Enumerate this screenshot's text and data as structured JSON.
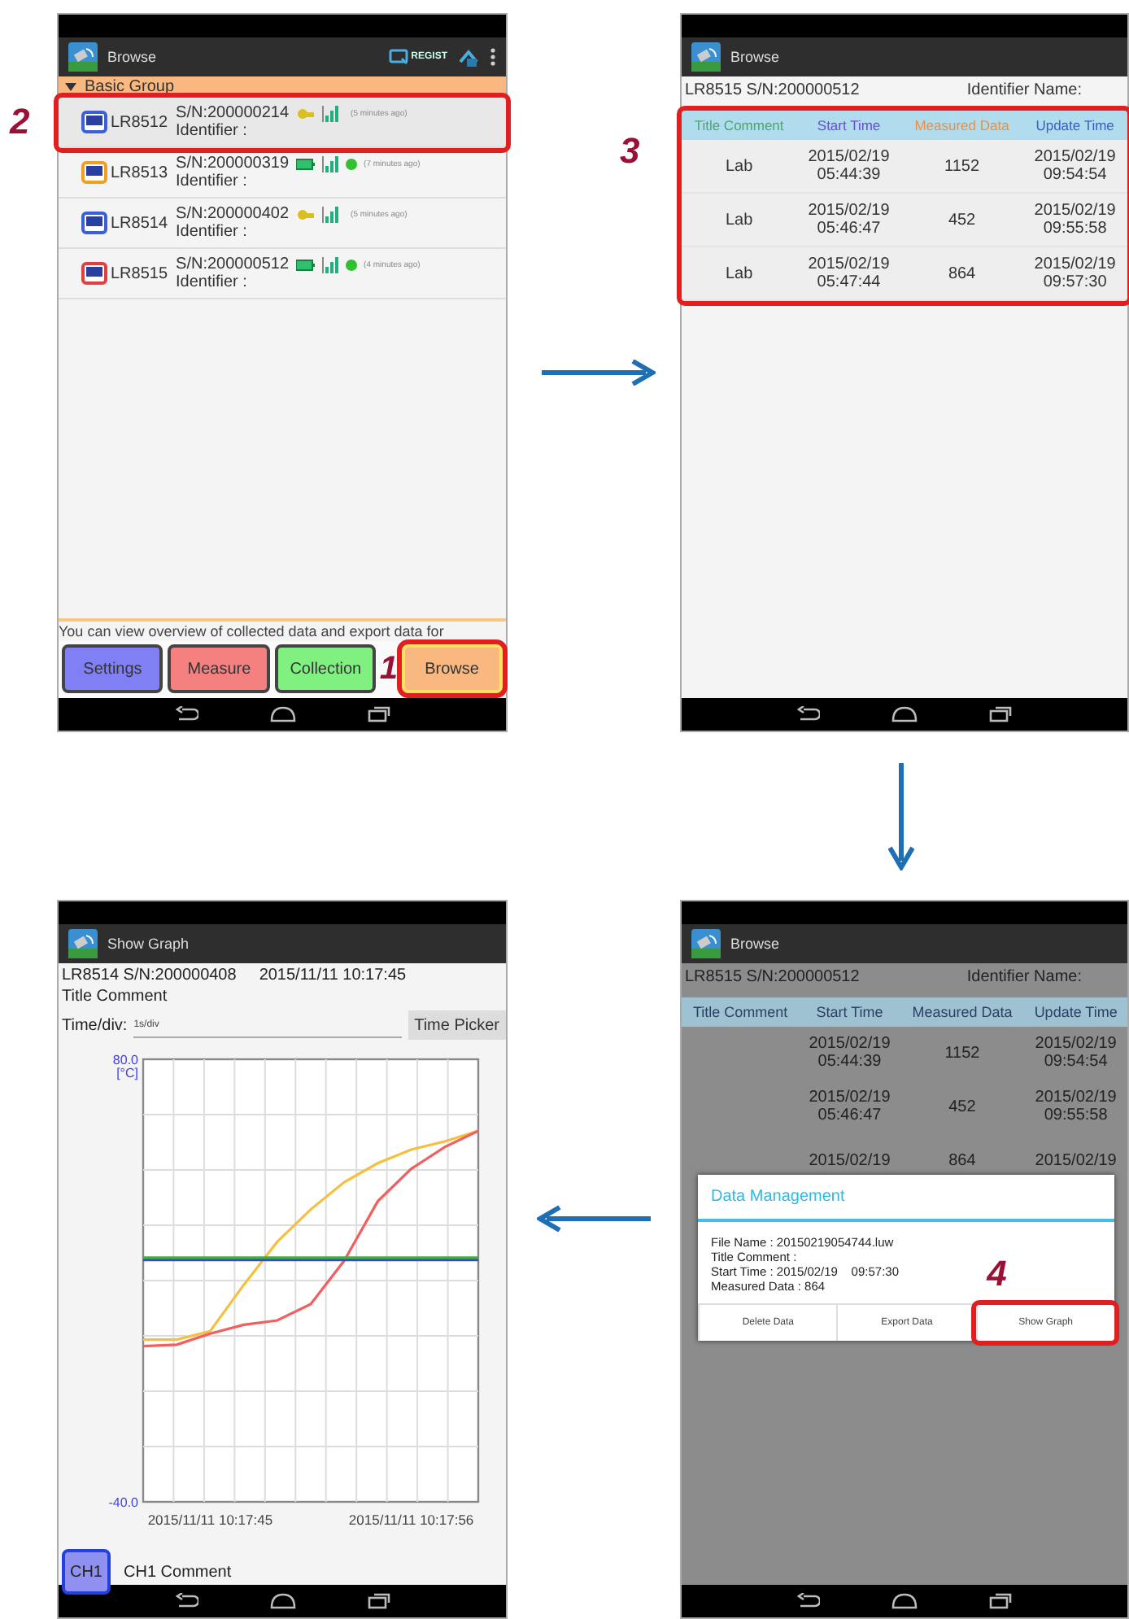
{
  "screens": [
    {
      "kind": "device_list",
      "title": "Browse",
      "regist_label": "REGIST",
      "group": {
        "label": "Basic Group",
        "expanded": true
      },
      "devices": [
        {
          "model": "LR8512",
          "serial": "S/N:200000214",
          "identifier": "Identifier :",
          "on_battery": false,
          "online": false,
          "ago": "(5 minutes ago)",
          "color": "#3b5fd6",
          "selected": true,
          "callout": "2"
        },
        {
          "model": "LR8513",
          "serial": "S/N:200000319",
          "identifier": "Identifier :",
          "on_battery": true,
          "online": true,
          "ago": "(7 minutes ago)",
          "color": "#f0a020",
          "selected": false
        },
        {
          "model": "LR8514",
          "serial": "S/N:200000402",
          "identifier": "Identifier :",
          "on_battery": false,
          "online": false,
          "ago": "(5 minutes ago)",
          "color": "#3b5fd6",
          "selected": false
        },
        {
          "model": "LR8515",
          "serial": "S/N:200000512",
          "identifier": "Identifier :",
          "on_battery": true,
          "online": true,
          "ago": "(4 minutes ago)",
          "color": "#e04040",
          "selected": false
        }
      ],
      "info_text": "You can view overview of collected data and export data for",
      "tabs": [
        {
          "label": "Settings",
          "color": "#8080f4",
          "selected": false
        },
        {
          "label": "Measure",
          "color": "#f48080",
          "selected": false
        },
        {
          "label": "Collection",
          "color": "#80f080",
          "selected": false
        },
        {
          "label": "Browse",
          "color": "#f8b880",
          "selected": true,
          "callout": "1"
        }
      ]
    },
    {
      "kind": "data_table",
      "title": "Browse",
      "dimmed": false,
      "device_label": "LR8515 S/N:200000512",
      "identifier_label": "Identifier Name:",
      "callout": "3",
      "columns": [
        {
          "label": "Title Comment",
          "color": "#4aa86a"
        },
        {
          "label": "Start Time",
          "color": "#6a4fc8"
        },
        {
          "label": "Measured Data",
          "color": "#e89048"
        },
        {
          "label": "Update Time",
          "color": "#3a5fc8"
        }
      ],
      "rows": [
        {
          "title_comment": "Lab",
          "start_time": "2015/02/19\n05:44:39",
          "measured_data": "1152",
          "update_time": "2015/02/19\n09:54:54"
        },
        {
          "title_comment": "Lab",
          "start_time": "2015/02/19\n05:46:47",
          "measured_data": "452",
          "update_time": "2015/02/19\n09:55:58"
        },
        {
          "title_comment": "Lab",
          "start_time": "2015/02/19\n05:47:44",
          "measured_data": "864",
          "update_time": "2015/02/19\n09:57:30"
        }
      ]
    },
    {
      "kind": "graph",
      "title": "Show Graph",
      "device_label": "LR8514 S/N:200000408",
      "timestamp": "2015/11/11 10:17:45",
      "title_comment": "Title Comment",
      "time_div": {
        "label": "Time/div:",
        "value": "1s/div"
      },
      "time_picker": "Time Picker",
      "chart_data": {
        "type": "line",
        "ylabel": "[°C]",
        "categories": [
          null,
          null,
          "2015/11/11 10:17:45",
          null,
          null,
          null,
          null,
          null,
          "2015/11/11 10:17:56",
          null,
          null
        ],
        "ylim": [
          -40,
          80
        ],
        "yticks": [
          {
            "value": 80,
            "label": "80.0"
          },
          {
            "value": -40,
            "label": "-40.0"
          }
        ],
        "series": [
          {
            "color": "#f5c040",
            "values": [
              4,
              4,
              6.3,
              18.8,
              30.5,
              39.3,
              46.7,
              51.8,
              55.5,
              57.7,
              60.6
            ]
          },
          {
            "color": "#f06060",
            "values": [
              2.2,
              2.6,
              5.6,
              8,
              9.2,
              13.6,
              25.4,
              41.5,
              50.3,
              56.2,
              60.6
            ]
          },
          {
            "color": "#3050c0",
            "values": [
              25.6,
              25.6,
              25.6,
              25.6,
              25.6,
              25.6,
              25.6,
              25.6,
              25.6,
              25.6,
              25.6
            ]
          },
          {
            "color": "#40b040",
            "values": [
              26.2,
              26.2,
              26.2,
              26.2,
              26.2,
              26.2,
              26.2,
              26.2,
              26.2,
              26.2,
              26.2
            ]
          }
        ]
      },
      "channels": [
        {
          "label": "CH1",
          "selected": true
        }
      ],
      "channel_comment": "CH1 Comment"
    },
    {
      "kind": "data_table",
      "title": "Browse",
      "dimmed": true,
      "device_label": "LR8515 S/N:200000512",
      "identifier_label": "Identifier Name:",
      "columns": [
        {
          "label": "Title Comment"
        },
        {
          "label": "Start Time"
        },
        {
          "label": "Measured Data"
        },
        {
          "label": "Update Time"
        }
      ],
      "rows": [
        {
          "start_time": "2015/02/19\n05:44:39",
          "measured_data": "1152",
          "update_time": "2015/02/19\n09:54:54"
        },
        {
          "start_time": "2015/02/19\n05:46:47",
          "measured_data": "452",
          "update_time": "2015/02/19\n09:55:58"
        },
        {
          "start_time": "2015/02/19",
          "measured_data": "864",
          "update_time": "2015/02/19"
        }
      ],
      "dialog": {
        "title": "Data Management",
        "lines": [
          "File Name : 20150219054744.luw",
          "Title Comment :",
          "Start Time : 2015/02/19    09:57:30",
          "Measured Data : 864"
        ],
        "buttons": [
          {
            "label": "Delete Data"
          },
          {
            "label": "Export Data"
          },
          {
            "label": "Show Graph",
            "callout": "4"
          }
        ]
      }
    }
  ]
}
